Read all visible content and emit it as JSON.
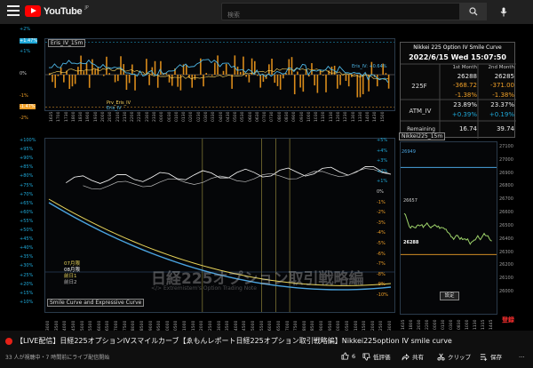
{
  "header": {
    "logo_text": "YouTube",
    "logo_country": "JP",
    "search_placeholder": "検索",
    "search_icon": "search-icon",
    "mic_icon": "mic-icon"
  },
  "video": {
    "live_badge_color": "#e62117",
    "title": "【LIVE配信】日経225オプションIVスマイルカーブ【ゑもんレポート日経225オプション取引戦略編】Nikkei225option IV smile curve",
    "viewer_info": "33 人が視聴中・7 時間前にライブ配信開始",
    "actions": {
      "like_count": "6",
      "dislike_label": "低評価",
      "share_label": "共有",
      "clip_label": "クリップ",
      "save_label": "保存",
      "more_label": "…"
    }
  },
  "chart_ui": {
    "eris_panel_title": "Eris_IV_15m",
    "eris_y_ticks": [
      "+2%",
      "+1.47%",
      "+1%",
      "0%",
      "-1%",
      "-1.47%",
      "-2%"
    ],
    "eris_legend": [
      "Prv_Eris_IV",
      "Eris_IV"
    ],
    "eris_last_label": "Eris_IV: +0.64%",
    "eris_x_ticks": [
      "1635",
      "1700",
      "1730",
      "1800",
      "1830",
      "1900",
      "1930",
      "2000",
      "2030",
      "2100",
      "2130",
      "2200",
      "2230",
      "2300",
      "2330",
      "0000",
      "0030",
      "0100",
      "0130",
      "0200",
      "0230",
      "0300",
      "0330",
      "0400",
      "0430",
      "0500",
      "0530",
      "0600",
      "0630",
      "0700",
      "0730",
      "0800",
      "0830",
      "0900",
      "0930",
      "1000",
      "1030",
      "1100",
      "1130",
      "1200",
      "1230",
      "1300",
      "1330",
      "1400",
      "1430",
      "1500"
    ],
    "info_table": {
      "title": "Nikkei 225 Option IV Smile Curve",
      "datetime": "2022/6/15 Wed 15:07:50",
      "col1": "1st Month",
      "col2": "2nd Month",
      "row225f_label": "225F",
      "row225f_1": "26288",
      "row225f_2": "26285",
      "row225f_chg1": "-368.72",
      "row225f_chg2": "-371.00",
      "row225f_pct1": "-1.38%",
      "row225f_pct2": "-1.38%",
      "atm_label": "ATM_IV",
      "atm_1": "23.89%",
      "atm_2": "23.37%",
      "atm_chg1": "+0.39%",
      "atm_chg2": "+0.19%",
      "remaining_label": "Remaining",
      "remaining_1": "16.74",
      "remaining_2": "39.74"
    },
    "nk_panel_title": "Nikkei225_15m",
    "nk_last_price": "26288",
    "nk_prev_high": "26657",
    "nk_y_ticks": [
      "27100",
      "27000",
      "26900",
      "26800",
      "26700",
      "26600",
      "26500",
      "26400",
      "26300",
      "26200",
      "26100",
      "26000"
    ],
    "nk_x_ticks": [
      "1635",
      "1800",
      "2030",
      "2200",
      "0000",
      "0130",
      "0300",
      "0830",
      "1000",
      "1130",
      "1315",
      "1445"
    ],
    "nk_button": "設定",
    "smile_panel_title": "Smile Curve and Expressive Curve",
    "smile_left_ticks": [
      "+100%",
      "+95%",
      "+90%",
      "+85%",
      "+80%",
      "+75%",
      "+70%",
      "+65%",
      "+60%",
      "+55%",
      "+50%",
      "+45%",
      "+40%",
      "+35%",
      "+30%",
      "+25%",
      "+20%",
      "+15%",
      "+10%"
    ],
    "smile_right_ticks": [
      "+5%",
      "+4%",
      "+3%",
      "+2%",
      "+1%",
      "0%",
      "-1%",
      "-2%",
      "-3%",
      "-4%",
      "-5%",
      "-6%",
      "-7%",
      "-8%",
      "-9%",
      "-10%"
    ],
    "smile_legend": [
      "07月限",
      "08月限",
      "前日1",
      "前日2"
    ],
    "smile_x_ticks": [
      "13000",
      "13500",
      "14000",
      "14500",
      "15000",
      "15500",
      "16000",
      "16500",
      "17000",
      "17500",
      "18000",
      "18500",
      "19000",
      "19500",
      "20000",
      "20500",
      "21000",
      "21500",
      "22000",
      "22500",
      "23000",
      "23500",
      "24000",
      "24500",
      "25000",
      "25500",
      "26000",
      "26500",
      "27000",
      "27500",
      "28000",
      "28500",
      "29000",
      "29500",
      "30000",
      "30500",
      "31000",
      "31500",
      "32000",
      "32500",
      "33000"
    ],
    "watermark_text": "日経225オプション取引戦略編",
    "watermark_sub": "</> Extremistem's Option Trading Note",
    "subscribe_label": "登録"
  },
  "colors": {
    "eris_bar_pos": "#d98b1a",
    "eris_line": "#4db6e6",
    "eris_prev_line": "#ffd75e",
    "smile_jul": "#e8d45a",
    "smile_aug": "#ffffff",
    "smile_prev1": "#4aa3df",
    "nk_price": "#9ed36a",
    "nk_top": "#4aa3df",
    "accent_cyan": "#1fa8d8",
    "accent_orange": "#f0a028"
  }
}
